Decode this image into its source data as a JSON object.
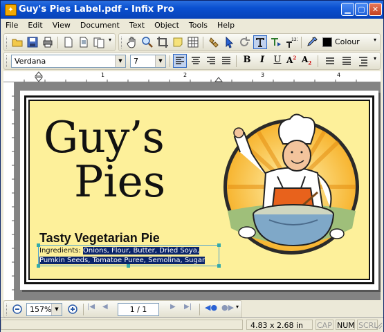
{
  "window": {
    "title": "Guy's Pies Label.pdf - Infix Pro"
  },
  "menu": [
    "File",
    "Edit",
    "View",
    "Document",
    "Text",
    "Object",
    "Tools",
    "Help"
  ],
  "toolbar": {
    "colour_label": "Colour"
  },
  "format": {
    "font_name": "Verdana",
    "font_size": "7"
  },
  "document": {
    "brand_line1": "Guy’s",
    "brand_line2": "Pies",
    "product_name": "Tasty Vegetarian Pie",
    "ingredients_label": "Ingredients:",
    "ingredients_line1": "Onions, Flour, Butter, Dried Soya,",
    "ingredients_line2": "Pumkin Seeds, Tomatoe Puree, Semolina, Sugar",
    "label_bg": "#fdf09a"
  },
  "nav": {
    "zoom": "157%",
    "page": "1 / 1"
  },
  "status": {
    "size": "4.83 x 2.68 in",
    "cap": "CAP",
    "num": "NUM",
    "scrl": "SCRL"
  },
  "ruler": {
    "marks": [
      "1",
      "2",
      "3",
      "4"
    ]
  }
}
